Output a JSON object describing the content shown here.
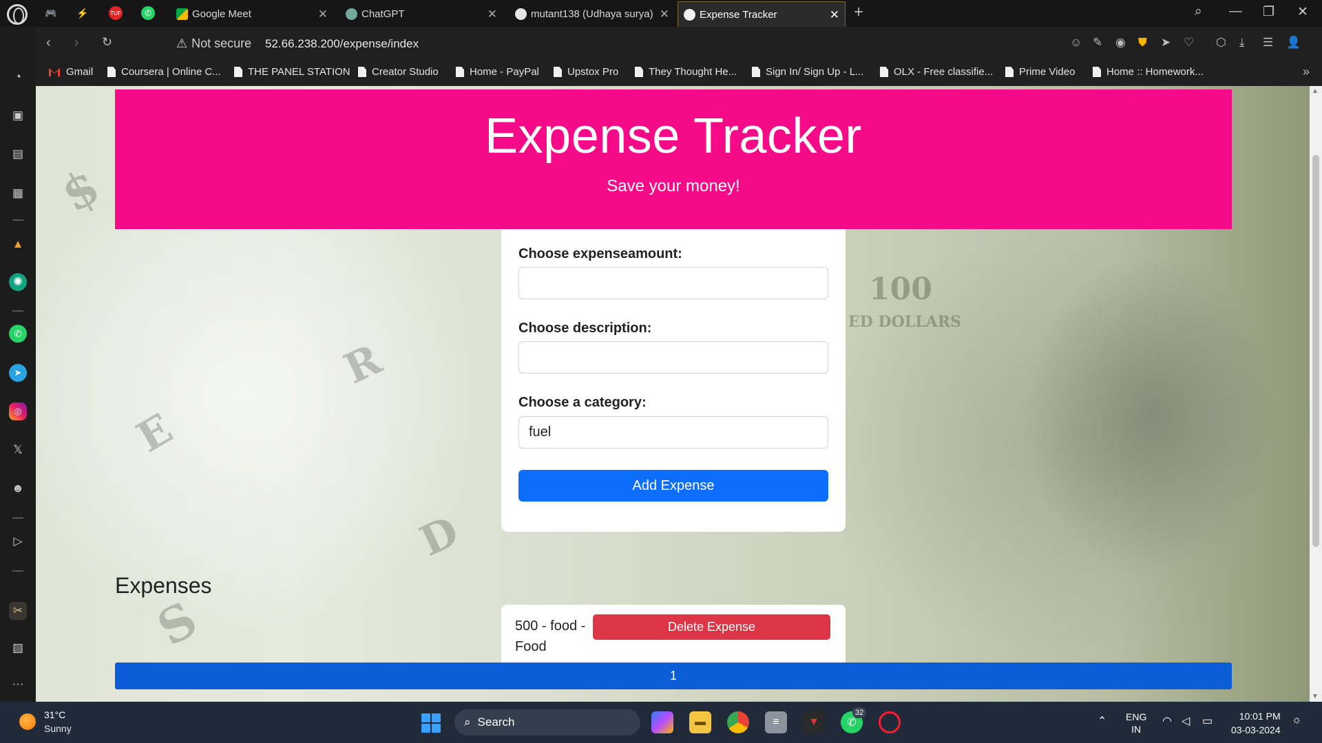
{
  "browser": {
    "tabs": [
      {
        "title": "Google Meet",
        "active": false
      },
      {
        "title": "ChatGPT",
        "active": false
      },
      {
        "title": "mutant138 (Udhaya surya)",
        "active": false
      },
      {
        "title": "Expense Tracker",
        "active": true
      }
    ],
    "security_label": "Not secure",
    "url": "52.66.238.200/expense/index",
    "bookmarks": [
      "Gmail",
      "Coursera | Online C...",
      "THE PANEL STATION",
      "Creator Studio",
      "Home - PayPal",
      "Upstox Pro",
      "They Thought He...",
      "Sign In/ Sign Up - L...",
      "OLX - Free classifie...",
      "Prime Video",
      "Home :: Homework..."
    ]
  },
  "page": {
    "header_title": "Expense Tracker",
    "header_subtitle": "Save your money!",
    "form": {
      "amount_label": "Choose expenseamount:",
      "amount_value": "",
      "description_label": "Choose description:",
      "description_value": "",
      "category_label": "Choose a category:",
      "category_value": "fuel",
      "submit_label": "Add Expense"
    },
    "expenses_title": "Expenses",
    "expenses": [
      {
        "text": "500 - food - Food",
        "delete_label": "Delete Expense"
      }
    ],
    "pagination": {
      "current_page": "1"
    }
  },
  "taskbar": {
    "weather_temp": "31°C",
    "weather_desc": "Sunny",
    "search_placeholder": "Search",
    "whatsapp_badge": "32",
    "language": "ENG",
    "region": "IN",
    "time": "10:01 PM",
    "date": "03-03-2024"
  },
  "colors": {
    "header_bg": "#f50a88",
    "primary_button": "#0d6efd",
    "danger_button": "#dc3545",
    "pager_bg": "#0b5ed7"
  }
}
